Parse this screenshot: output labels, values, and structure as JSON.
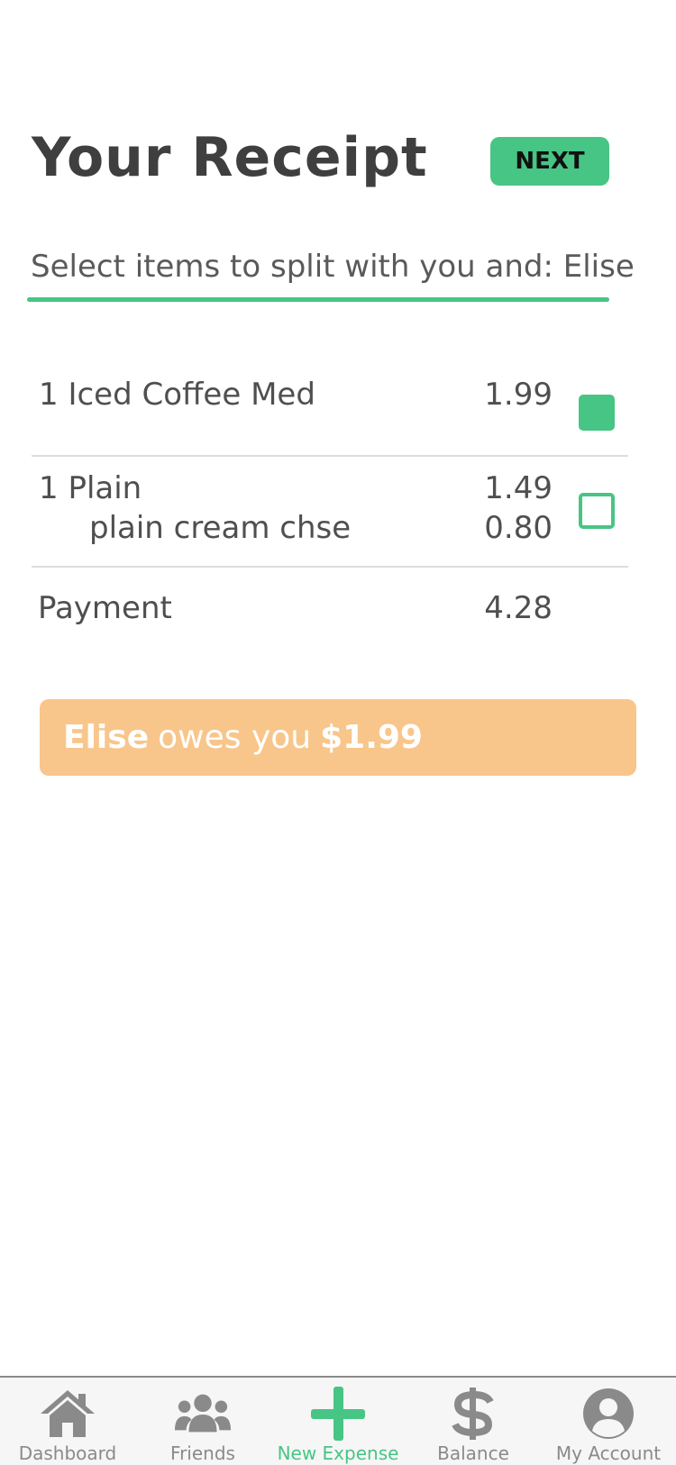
{
  "header": {
    "title": "Your Receipt",
    "next_label": "NEXT"
  },
  "split": {
    "prompt": "Select items to split with you and: Elise"
  },
  "items": [
    {
      "name": "1 Iced Coffee Med",
      "price": "1.99",
      "selected": true
    },
    {
      "name": "1 Plain",
      "price": "1.49",
      "sub_name": "plain cream chse",
      "sub_price": "0.80",
      "selected": false
    }
  ],
  "payment": {
    "label": "Payment",
    "amount": "4.28"
  },
  "owes": {
    "person": "Elise",
    "text": "owes you",
    "amount": "$1.99"
  },
  "nav": [
    {
      "label": "Dashboard",
      "icon": "home-icon"
    },
    {
      "label": "Friends",
      "icon": "users-icon"
    },
    {
      "label": "New Expense",
      "icon": "plus-icon",
      "active": true
    },
    {
      "label": "Balance",
      "icon": "dollar-icon"
    },
    {
      "label": "My Account",
      "icon": "account-icon"
    }
  ],
  "colors": {
    "accent": "#47c584",
    "banner": "#f8c68b",
    "nav_inactive": "#8a8a8a"
  }
}
